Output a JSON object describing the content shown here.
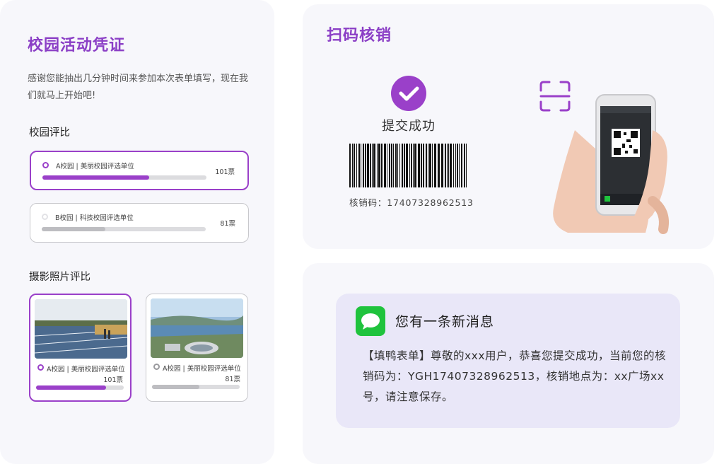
{
  "left": {
    "title": "校园活动凭证",
    "description": "感谢您能抽出几分钟时间来参加本次表单填写，现在我们就马上开始吧!",
    "campus": {
      "section_title": "校园评比",
      "options": [
        {
          "label": "A校园 | 美丽校园评选单位",
          "count": "101票",
          "selected": true,
          "progress": 0.65
        },
        {
          "label": "B校园 | 科技校园评选单位",
          "count": "81票",
          "selected": false,
          "progress": 0.39
        }
      ]
    },
    "photo": {
      "section_title": "摄影照片评比",
      "options": [
        {
          "label": "A校园 | 美丽校园评选单位",
          "count": "101票",
          "selected": true,
          "progress": 0.8
        },
        {
          "label": "A校园 | 美丽校园评选单位",
          "count": "81票",
          "selected": false,
          "progress": 0.54
        }
      ]
    }
  },
  "scan": {
    "title": "扫码核销",
    "success_text": "提交成功",
    "code_label": "核销码：",
    "code_value": "17407328962513"
  },
  "message": {
    "title": "您有一条新消息",
    "body": "【填鸭表单】尊敬的xxx用户，恭喜您提交成功，当前您的核销码为：YGH17407328962513，核销地点为：xx广场xx号，请注意保存。"
  },
  "icons": {
    "check": "check-circle-icon",
    "scan": "scan-frame-icon",
    "chat": "wechat-icon"
  },
  "colors": {
    "accent": "#9a40c9",
    "wechat_green": "#1fc33d",
    "bubble_bg": "#e9e7f8"
  }
}
